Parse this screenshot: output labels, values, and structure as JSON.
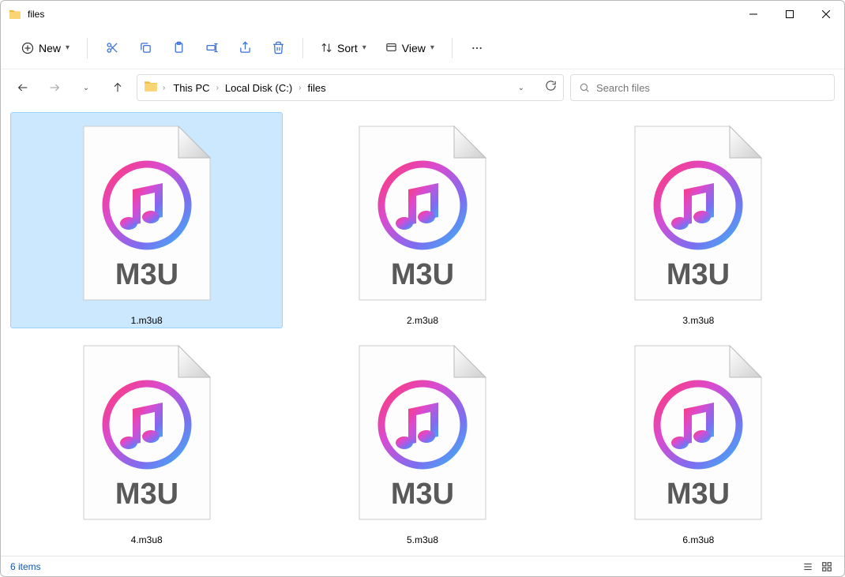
{
  "window": {
    "title": "files"
  },
  "toolbar": {
    "new_label": "New",
    "sort_label": "Sort",
    "view_label": "View"
  },
  "breadcrumb": {
    "parts": [
      "This PC",
      "Local Disk (C:)",
      "files"
    ]
  },
  "search": {
    "placeholder": "Search files"
  },
  "files": [
    {
      "name": "1.m3u8",
      "type_label": "M3U",
      "selected": true
    },
    {
      "name": "2.m3u8",
      "type_label": "M3U",
      "selected": false
    },
    {
      "name": "3.m3u8",
      "type_label": "M3U",
      "selected": false
    },
    {
      "name": "4.m3u8",
      "type_label": "M3U",
      "selected": false
    },
    {
      "name": "5.m3u8",
      "type_label": "M3U",
      "selected": false
    },
    {
      "name": "6.m3u8",
      "type_label": "M3U",
      "selected": false
    }
  ],
  "status": {
    "count_text": "6 items"
  }
}
